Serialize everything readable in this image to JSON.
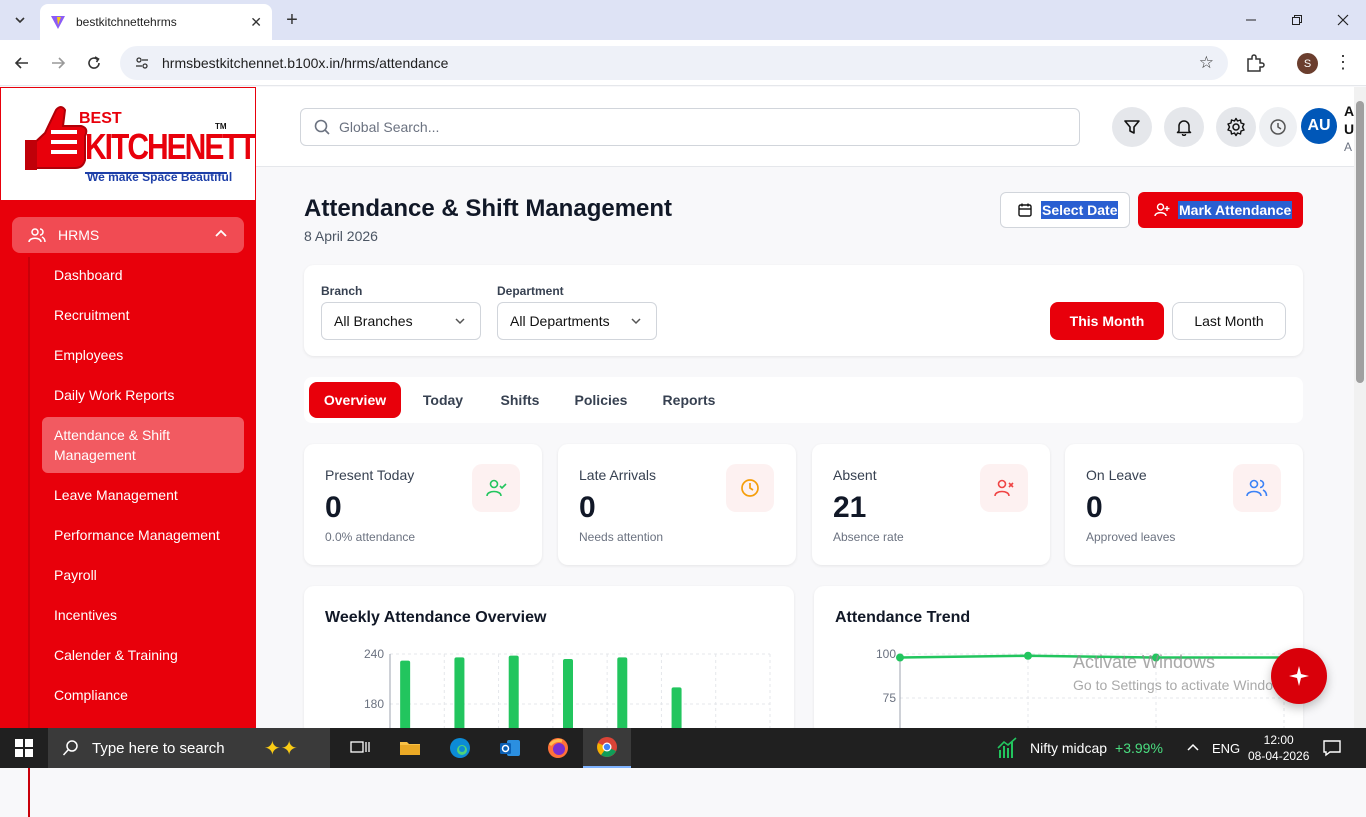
{
  "browser": {
    "tab_title": "bestkitchnettehrms",
    "url": "hrmsbestkitchennet.b100x.in/hrms/attendance",
    "profile_initial": "S"
  },
  "logo": {
    "line1": "BEST",
    "line2": "KITCHENETTE",
    "tm": "TM",
    "tagline": "We make Space Beautiful"
  },
  "sidebar": {
    "group": "HRMS",
    "items": [
      {
        "label": "Dashboard"
      },
      {
        "label": "Recruitment"
      },
      {
        "label": "Employees"
      },
      {
        "label": "Daily Work Reports"
      },
      {
        "label": "Attendance & Shift Management"
      },
      {
        "label": "Leave Management"
      },
      {
        "label": "Performance Management"
      },
      {
        "label": "Payroll"
      },
      {
        "label": "Incentives"
      },
      {
        "label": "Calender & Training"
      },
      {
        "label": "Compliance"
      }
    ]
  },
  "header": {
    "search_placeholder": "Global Search...",
    "avatar": "AU",
    "user_line1": "A",
    "user_line2": "U",
    "user_line3": "A"
  },
  "page": {
    "title": "Attendance & Shift Management",
    "date": "8 April 2026",
    "select_date": "Select Date",
    "mark_attendance": "Mark Attendance"
  },
  "filters": {
    "branch_label": "Branch",
    "branch_value": "All Branches",
    "department_label": "Department",
    "department_value": "All Departments",
    "this_month": "This Month",
    "last_month": "Last Month"
  },
  "tabs": [
    "Overview",
    "Today",
    "Shifts",
    "Policies",
    "Reports"
  ],
  "stats": [
    {
      "label": "Present Today",
      "value": "0",
      "sub": "0.0% attendance",
      "color": "#22c55e",
      "icon": "user-check-icon"
    },
    {
      "label": "Late Arrivals",
      "value": "0",
      "sub": "Needs attention",
      "color": "#f59e0b",
      "icon": "clock-icon"
    },
    {
      "label": "Absent",
      "value": "21",
      "sub": "Absence rate",
      "color": "#ef4444",
      "icon": "user-x-icon"
    },
    {
      "label": "On Leave",
      "value": "0",
      "sub": "Approved leaves",
      "color": "#3b82f6",
      "icon": "users-icon"
    }
  ],
  "chart_data": [
    {
      "type": "bar",
      "title": "Weekly Attendance Overview",
      "yticks": [
        "240",
        "180"
      ],
      "ylim": [
        0,
        240
      ],
      "values": [
        232,
        236,
        238,
        234,
        236,
        200
      ],
      "color": "#22c55e",
      "grid": true
    },
    {
      "type": "line",
      "title": "Attendance Trend",
      "yticks": [
        "100",
        "75"
      ],
      "ylim": [
        75,
        100
      ],
      "values": [
        98,
        99,
        98,
        98
      ],
      "color": "#22c55e",
      "grid": true
    }
  ],
  "watermark": {
    "line1": "Activate Windows",
    "line2": "Go to Settings to activate Windows."
  },
  "taskbar": {
    "search": "Type here to search",
    "stock_name": "Nifty midcap",
    "stock_change": "+3.99%",
    "lang": "ENG",
    "time": "12:00",
    "date": "08-04-2026"
  },
  "colors": {
    "brand": "#e8000b",
    "success": "#22c55e"
  }
}
